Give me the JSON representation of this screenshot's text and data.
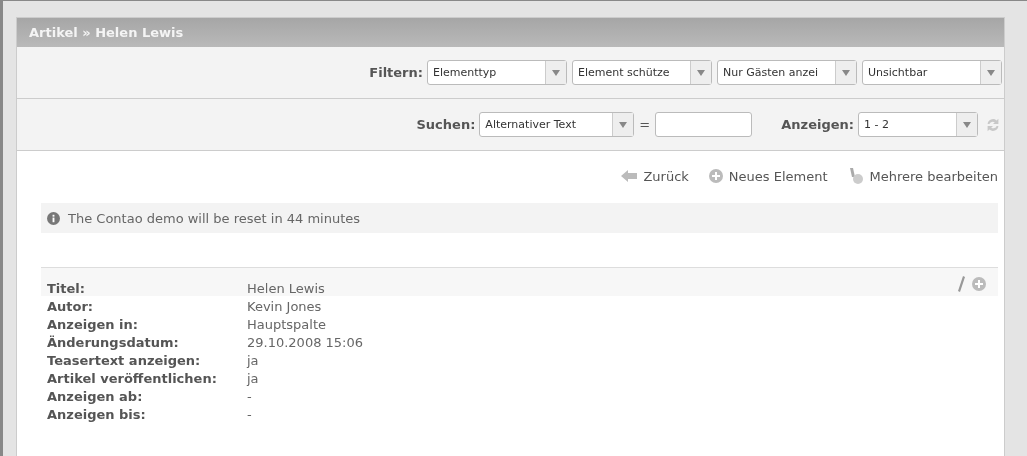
{
  "header": {
    "title": "Artikel » Helen Lewis"
  },
  "filter": {
    "label": "Filtern:",
    "selects": [
      {
        "value": "Elementtyp"
      },
      {
        "value": "Element schütze"
      },
      {
        "value": "Nur Gästen anzei"
      },
      {
        "value": "Unsichtbar"
      }
    ]
  },
  "search": {
    "label": "Suchen:",
    "field_select": "Alternativer Text",
    "operator": "=",
    "value_label": "Anzeigen:",
    "range": "1 - 2"
  },
  "actions": [
    {
      "kind": "back",
      "label": "Zurück"
    },
    {
      "kind": "new",
      "label": "Neues Element"
    },
    {
      "kind": "multi",
      "label": "Mehrere bearbeiten"
    }
  ],
  "info": "The Contao demo will be reset in 44 minutes",
  "record": {
    "fields": [
      {
        "label": "Titel:",
        "value": "Helen Lewis"
      },
      {
        "label": "Autor:",
        "value": "Kevin Jones"
      },
      {
        "label": "Anzeigen in:",
        "value": "Hauptspalte"
      },
      {
        "label": "Änderungsdatum:",
        "value": "29.10.2008 15:06"
      },
      {
        "label": "Teasertext anzeigen:",
        "value": "ja"
      },
      {
        "label": "Artikel veröffentlichen:",
        "value": "ja"
      },
      {
        "label": "Anzeigen ab:",
        "value": "-"
      },
      {
        "label": "Anzeigen bis:",
        "value": "-"
      }
    ]
  }
}
